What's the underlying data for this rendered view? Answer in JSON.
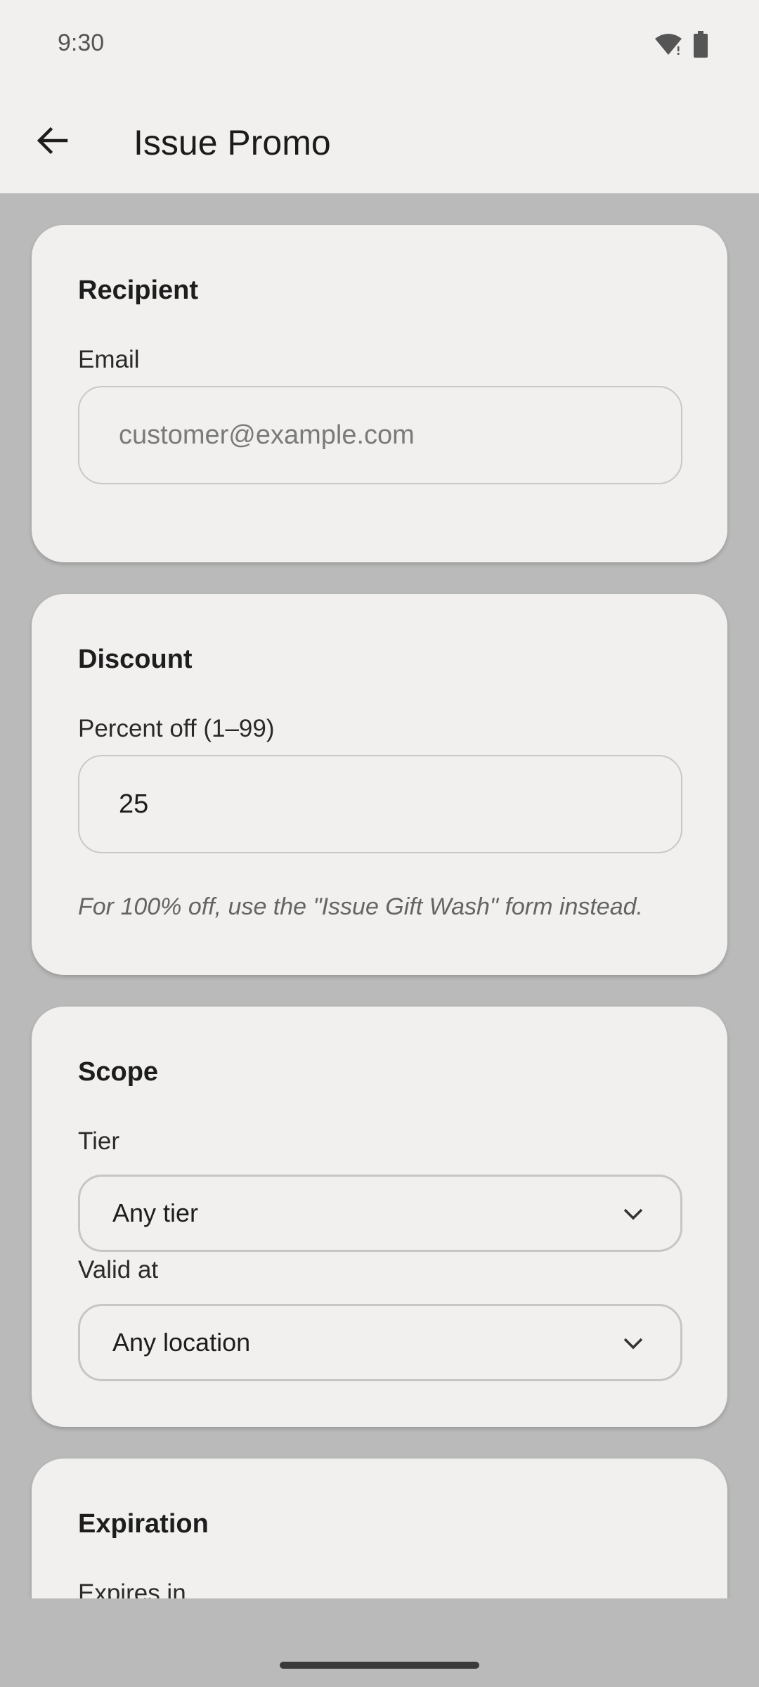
{
  "status_bar": {
    "time": "9:30"
  },
  "app_bar": {
    "title": "Issue Promo"
  },
  "recipient": {
    "title": "Recipient",
    "email_label": "Email",
    "email_placeholder": "customer@example.com",
    "email_value": ""
  },
  "discount": {
    "title": "Discount",
    "percent_label": "Percent off (1–99)",
    "percent_value": "25",
    "hint": "For 100% off, use the \"Issue Gift Wash\" form instead."
  },
  "scope": {
    "title": "Scope",
    "tier_label": "Tier",
    "tier_value": "Any tier",
    "location_label": "Valid at",
    "location_value": "Any location"
  },
  "expiration": {
    "title": "Expiration",
    "expires_label": "Expires in"
  },
  "colors": {
    "surface": "#f1f0ee",
    "background": "#b9bab9",
    "text": "#1d1d1d"
  }
}
